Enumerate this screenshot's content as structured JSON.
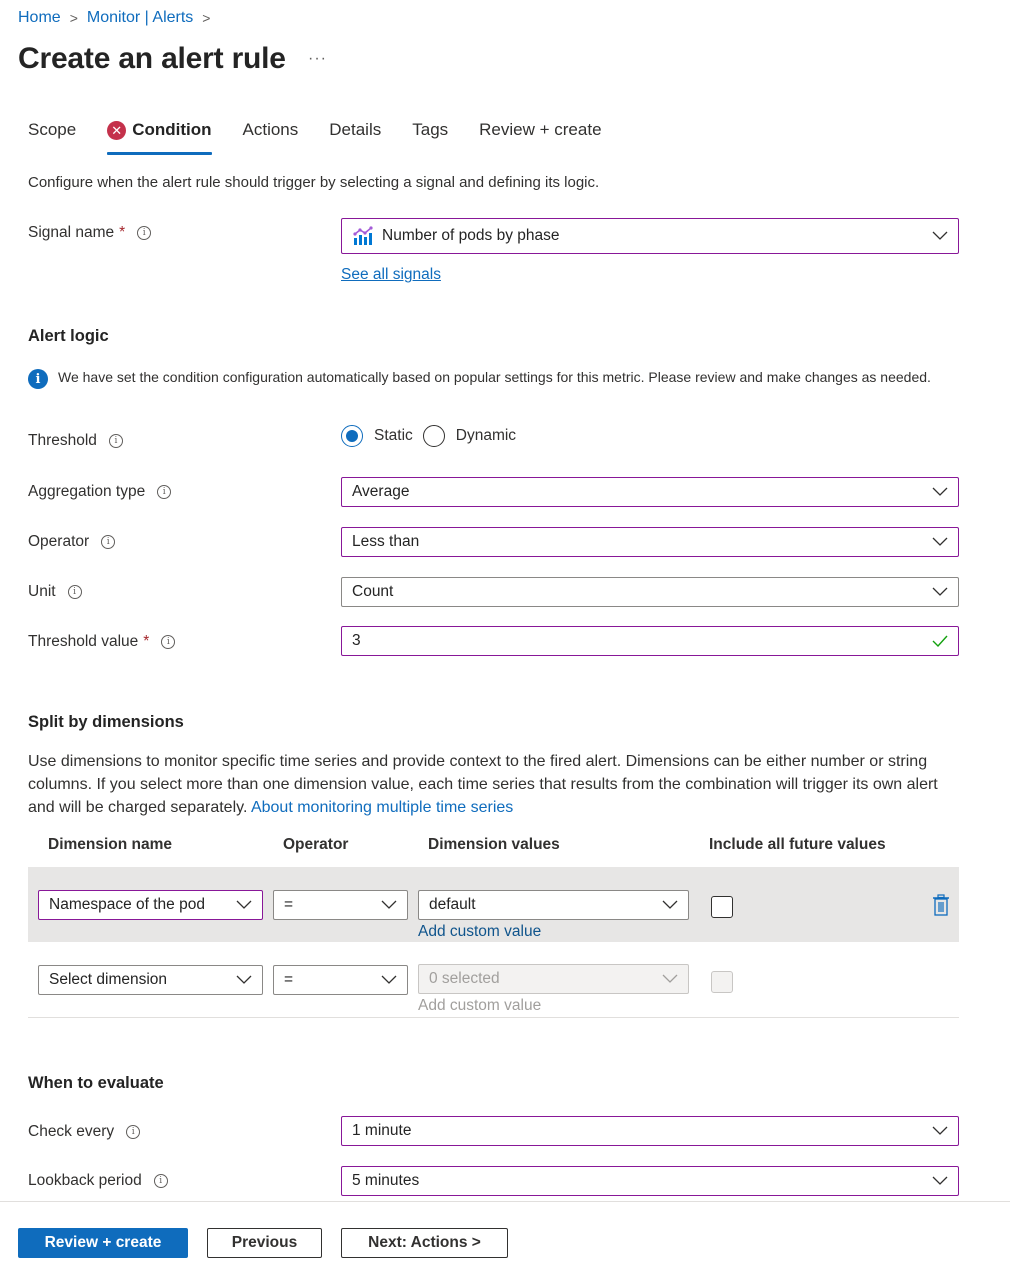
{
  "breadcrumb": [
    {
      "label": "Home"
    },
    {
      "label": "Monitor | Alerts"
    }
  ],
  "page": {
    "title": "Create an alert rule",
    "more_label": "···"
  },
  "tabs": [
    {
      "label": "Scope",
      "active": false,
      "error": false
    },
    {
      "label": "Condition",
      "active": true,
      "error": true
    },
    {
      "label": "Actions",
      "active": false,
      "error": false
    },
    {
      "label": "Details",
      "active": false,
      "error": false
    },
    {
      "label": "Tags",
      "active": false,
      "error": false
    },
    {
      "label": "Review + create",
      "active": false,
      "error": false
    }
  ],
  "description": "Configure when the alert rule should trigger by selecting a signal and defining its logic.",
  "signal": {
    "label": "Signal name",
    "required_mark": "*",
    "value": "Number of pods by phase",
    "icon": "metric-chart-icon",
    "see_all_link": "See all signals"
  },
  "alert_logic": {
    "heading": "Alert logic",
    "info_text": "We have set the condition configuration automatically based on popular settings for this metric. Please review and make changes as needed.",
    "info_icon_glyph": "i",
    "threshold": {
      "label": "Threshold",
      "options": [
        {
          "label": "Static",
          "selected": true
        },
        {
          "label": "Dynamic",
          "selected": false
        }
      ]
    },
    "aggregation_type": {
      "label": "Aggregation type",
      "value": "Average"
    },
    "operator": {
      "label": "Operator",
      "value": "Less than"
    },
    "unit": {
      "label": "Unit",
      "value": "Count"
    },
    "threshold_value": {
      "label": "Threshold value",
      "required_mark": "*",
      "value": "3",
      "valid": true
    }
  },
  "split": {
    "heading": "Split by dimensions",
    "description": "Use dimensions to monitor specific time series and provide context to the fired alert. Dimensions can be either number or string columns. If you select more than one dimension value, each time series that results from the combination will trigger its own alert and will be charged separately.",
    "link": "About monitoring multiple time series",
    "columns": [
      "Dimension name",
      "Operator",
      "Dimension values",
      "Include all future values"
    ],
    "rows": [
      {
        "name": "Namespace of the pod",
        "operator": "=",
        "values": "default",
        "add_custom": "Add custom value",
        "include_future": false,
        "disabled": false
      },
      {
        "name": "Select dimension",
        "operator": "=",
        "values": "0 selected",
        "add_custom": "Add custom value",
        "include_future": false,
        "disabled": true
      }
    ]
  },
  "evaluate": {
    "heading": "When to evaluate",
    "check_every": {
      "label": "Check every",
      "value": "1 minute"
    },
    "lookback": {
      "label": "Lookback period",
      "value": "5 minutes"
    }
  },
  "footer": {
    "review_create": "Review + create",
    "previous": "Previous",
    "next": "Next: Actions >"
  },
  "colors": {
    "accent": "#0f6cbd",
    "focus_border": "#881798",
    "error": "#c4314b",
    "valid": "#13a10e"
  }
}
